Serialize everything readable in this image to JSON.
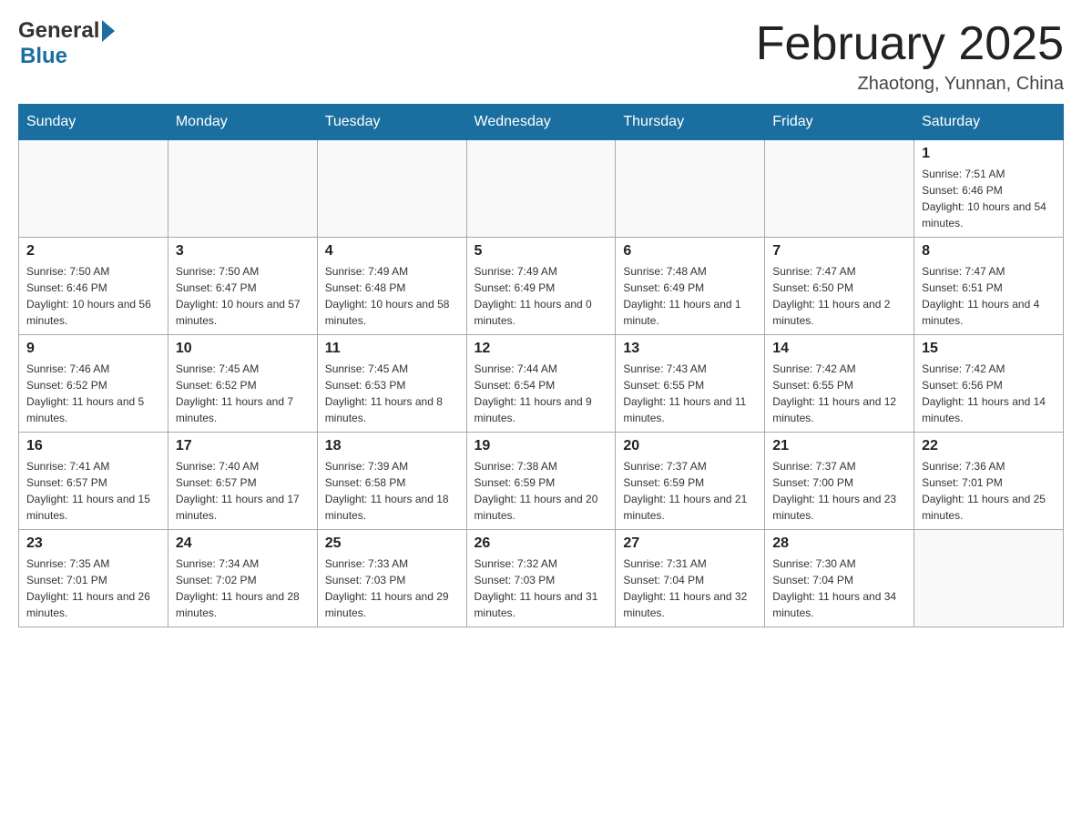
{
  "header": {
    "title": "February 2025",
    "location": "Zhaotong, Yunnan, China"
  },
  "logo": {
    "part1": "General",
    "part2": "Blue"
  },
  "weekdays": [
    "Sunday",
    "Monday",
    "Tuesday",
    "Wednesday",
    "Thursday",
    "Friday",
    "Saturday"
  ],
  "weeks": [
    [
      {
        "day": "",
        "info": ""
      },
      {
        "day": "",
        "info": ""
      },
      {
        "day": "",
        "info": ""
      },
      {
        "day": "",
        "info": ""
      },
      {
        "day": "",
        "info": ""
      },
      {
        "day": "",
        "info": ""
      },
      {
        "day": "1",
        "info": "Sunrise: 7:51 AM\nSunset: 6:46 PM\nDaylight: 10 hours and 54 minutes."
      }
    ],
    [
      {
        "day": "2",
        "info": "Sunrise: 7:50 AM\nSunset: 6:46 PM\nDaylight: 10 hours and 56 minutes."
      },
      {
        "day": "3",
        "info": "Sunrise: 7:50 AM\nSunset: 6:47 PM\nDaylight: 10 hours and 57 minutes."
      },
      {
        "day": "4",
        "info": "Sunrise: 7:49 AM\nSunset: 6:48 PM\nDaylight: 10 hours and 58 minutes."
      },
      {
        "day": "5",
        "info": "Sunrise: 7:49 AM\nSunset: 6:49 PM\nDaylight: 11 hours and 0 minutes."
      },
      {
        "day": "6",
        "info": "Sunrise: 7:48 AM\nSunset: 6:49 PM\nDaylight: 11 hours and 1 minute."
      },
      {
        "day": "7",
        "info": "Sunrise: 7:47 AM\nSunset: 6:50 PM\nDaylight: 11 hours and 2 minutes."
      },
      {
        "day": "8",
        "info": "Sunrise: 7:47 AM\nSunset: 6:51 PM\nDaylight: 11 hours and 4 minutes."
      }
    ],
    [
      {
        "day": "9",
        "info": "Sunrise: 7:46 AM\nSunset: 6:52 PM\nDaylight: 11 hours and 5 minutes."
      },
      {
        "day": "10",
        "info": "Sunrise: 7:45 AM\nSunset: 6:52 PM\nDaylight: 11 hours and 7 minutes."
      },
      {
        "day": "11",
        "info": "Sunrise: 7:45 AM\nSunset: 6:53 PM\nDaylight: 11 hours and 8 minutes."
      },
      {
        "day": "12",
        "info": "Sunrise: 7:44 AM\nSunset: 6:54 PM\nDaylight: 11 hours and 9 minutes."
      },
      {
        "day": "13",
        "info": "Sunrise: 7:43 AM\nSunset: 6:55 PM\nDaylight: 11 hours and 11 minutes."
      },
      {
        "day": "14",
        "info": "Sunrise: 7:42 AM\nSunset: 6:55 PM\nDaylight: 11 hours and 12 minutes."
      },
      {
        "day": "15",
        "info": "Sunrise: 7:42 AM\nSunset: 6:56 PM\nDaylight: 11 hours and 14 minutes."
      }
    ],
    [
      {
        "day": "16",
        "info": "Sunrise: 7:41 AM\nSunset: 6:57 PM\nDaylight: 11 hours and 15 minutes."
      },
      {
        "day": "17",
        "info": "Sunrise: 7:40 AM\nSunset: 6:57 PM\nDaylight: 11 hours and 17 minutes."
      },
      {
        "day": "18",
        "info": "Sunrise: 7:39 AM\nSunset: 6:58 PM\nDaylight: 11 hours and 18 minutes."
      },
      {
        "day": "19",
        "info": "Sunrise: 7:38 AM\nSunset: 6:59 PM\nDaylight: 11 hours and 20 minutes."
      },
      {
        "day": "20",
        "info": "Sunrise: 7:37 AM\nSunset: 6:59 PM\nDaylight: 11 hours and 21 minutes."
      },
      {
        "day": "21",
        "info": "Sunrise: 7:37 AM\nSunset: 7:00 PM\nDaylight: 11 hours and 23 minutes."
      },
      {
        "day": "22",
        "info": "Sunrise: 7:36 AM\nSunset: 7:01 PM\nDaylight: 11 hours and 25 minutes."
      }
    ],
    [
      {
        "day": "23",
        "info": "Sunrise: 7:35 AM\nSunset: 7:01 PM\nDaylight: 11 hours and 26 minutes."
      },
      {
        "day": "24",
        "info": "Sunrise: 7:34 AM\nSunset: 7:02 PM\nDaylight: 11 hours and 28 minutes."
      },
      {
        "day": "25",
        "info": "Sunrise: 7:33 AM\nSunset: 7:03 PM\nDaylight: 11 hours and 29 minutes."
      },
      {
        "day": "26",
        "info": "Sunrise: 7:32 AM\nSunset: 7:03 PM\nDaylight: 11 hours and 31 minutes."
      },
      {
        "day": "27",
        "info": "Sunrise: 7:31 AM\nSunset: 7:04 PM\nDaylight: 11 hours and 32 minutes."
      },
      {
        "day": "28",
        "info": "Sunrise: 7:30 AM\nSunset: 7:04 PM\nDaylight: 11 hours and 34 minutes."
      },
      {
        "day": "",
        "info": ""
      }
    ]
  ]
}
